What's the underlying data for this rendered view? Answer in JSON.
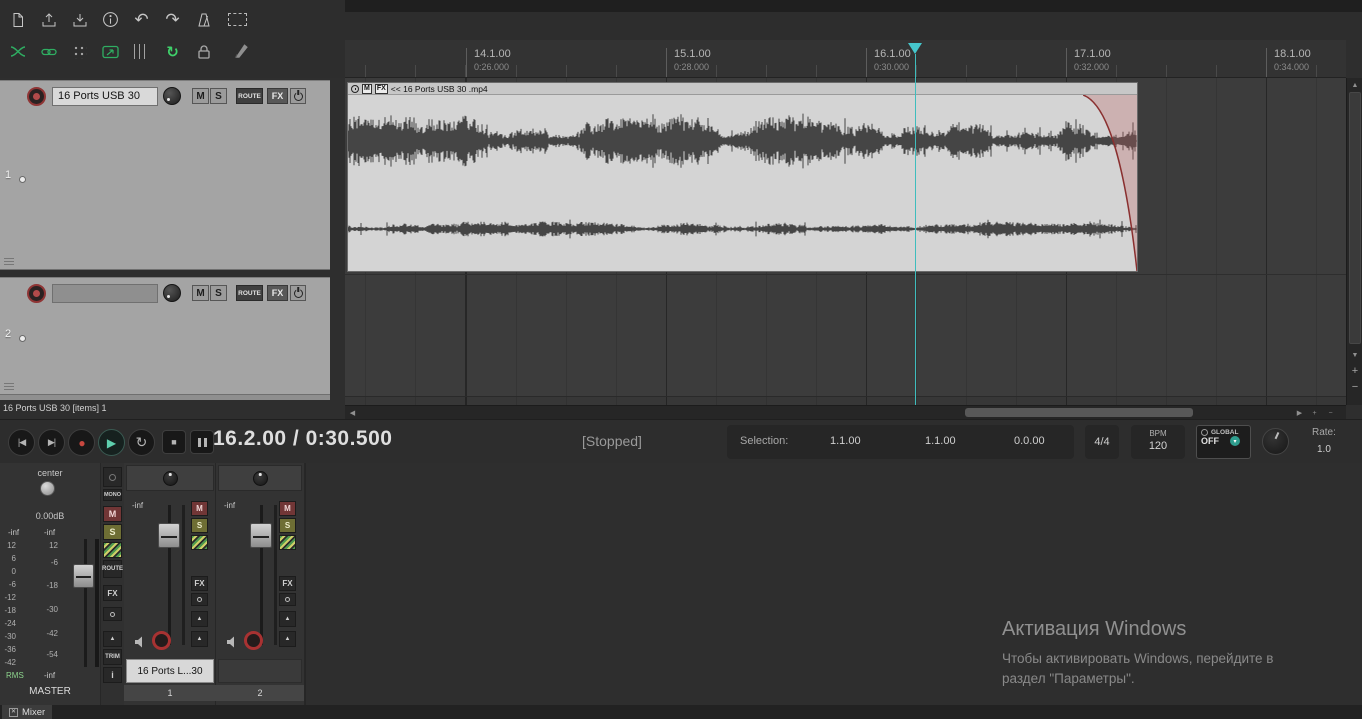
{
  "toolbar": {
    "icons": [
      "new-project",
      "open-project",
      "save-project",
      "project-info",
      "undo",
      "redo",
      "metronome",
      "marquee",
      "crossfade-tool",
      "item-grouping",
      "grid-dots",
      "envelope-tool",
      "snap-grid",
      "ripple-loop",
      "lock",
      "draw-pen"
    ],
    "undo_glyph": "↶",
    "redo_glyph": "↷",
    "ripple_glyph": "↻"
  },
  "timeline": {
    "markers": [
      {
        "bar": "14.1.00",
        "time": "0:26.000"
      },
      {
        "bar": "15.1.00",
        "time": "0:28.000"
      },
      {
        "bar": "16.1.00",
        "time": "0:30.000"
      },
      {
        "bar": "17.1.00",
        "time": "0:32.000"
      },
      {
        "bar": "18.1.00",
        "time": "0:34.000"
      }
    ]
  },
  "track_buttons": {
    "mute": "M",
    "solo": "S",
    "route": "ROUTE",
    "fx": "FX"
  },
  "tracks": [
    {
      "number": "1",
      "name": "16 Ports USB 30"
    },
    {
      "number": "2",
      "name": ""
    }
  ],
  "status_bar": {
    "text": "16 Ports USB 30 [items] 1"
  },
  "media_item": {
    "mute": "M",
    "fx": "FX",
    "title": "<< 16 Ports USB 30 .mp4"
  },
  "transport": {
    "buttons": {
      "goto_start": "|◀",
      "goto_end": "▶|",
      "record": "●",
      "play": "▶",
      "repeat": "↻",
      "stop": "■"
    },
    "time": "16.2.00 / 0:30.500",
    "status": "[Stopped]",
    "selection_label": "Selection:",
    "sel_start": "1.1.00",
    "sel_end": "1.1.00",
    "sel_len": "0.0.00",
    "time_sig": "4/4",
    "bpm_label": "BPM",
    "bpm": "120",
    "global_label": "GLOBAL",
    "global_value": "OFF",
    "global_dd": "▾",
    "rate_label": "Rate:",
    "rate": "1.0"
  },
  "mixer": {
    "master": {
      "pan": "center",
      "volume": "0.00dB",
      "peak_l": "-inf",
      "peak_r": "-inf",
      "scale_left": [
        "12",
        "6",
        "0",
        "-6",
        "-12",
        "-18",
        "-24",
        "-30",
        "-36",
        "-42"
      ],
      "scale_right": [
        "12",
        "-6",
        "-18",
        "-30",
        "-42",
        "-54"
      ],
      "rms_label": "RMS",
      "rms_value": "-inf",
      "name": "MASTER"
    },
    "master_buttons": {
      "mono": "MONO",
      "mute": "M",
      "solo": "S",
      "route": "ROUTE",
      "fx": "FX",
      "trim": "TRIM",
      "info": "i",
      "arrow": "▲"
    },
    "channel_buttons": {
      "mute": "M",
      "solo": "S",
      "fx": "FX",
      "arrow": "▲"
    },
    "channels": [
      {
        "number": "1",
        "name": "16 Ports L...30",
        "gain": "-inf"
      },
      {
        "number": "2",
        "name": "",
        "gain": "-inf"
      }
    ]
  },
  "docker": {
    "tab_label": "Mixer",
    "close_glyph": "✕"
  },
  "watermark": {
    "title": "Активация Windows",
    "line1": "Чтобы активировать Windows, перейдите в",
    "line2": "раздел \"Параметры\"."
  }
}
